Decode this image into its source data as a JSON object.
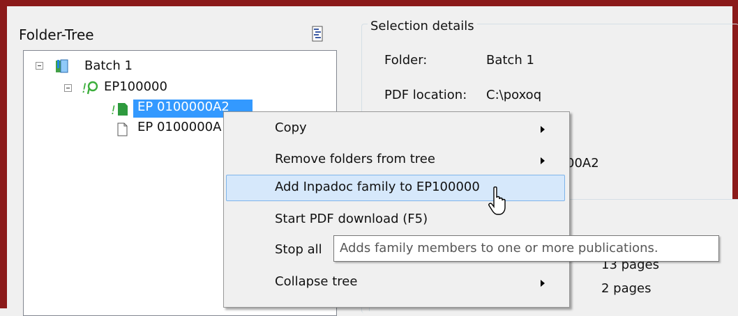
{
  "folder_tree": {
    "title": "Folder-Tree",
    "options_icon": "tree-options-icon",
    "nodes": [
      {
        "label": "Batch 1",
        "icon": "batch-book-icon"
      },
      {
        "label": "EP100000",
        "icon": "family-green-icon"
      },
      {
        "label": "EP 0100000A2",
        "icon": "green-document-icon",
        "selected": true
      },
      {
        "label": "EP 0100000A",
        "icon": "white-document-icon"
      }
    ]
  },
  "selection_details": {
    "title": "Selection details",
    "folder_label": "Folder:",
    "folder_value": "Batch 1",
    "pdf_location_label": "PDF location:",
    "pdf_location_value": "C:\\poxoq",
    "partial_text": "00A2",
    "pages_1": "13 pages",
    "pages_2": "2 pages"
  },
  "context_menu": {
    "items": [
      {
        "label": "Copy",
        "submenu": true
      },
      {
        "label": "Remove folders from tree",
        "submenu": true
      },
      {
        "label": "Add Inpadoc family to EP100000",
        "submenu": false,
        "hovered": true
      },
      {
        "label": "Start PDF download (F5)",
        "submenu": false
      },
      {
        "label": "Stop all",
        "submenu": false
      },
      {
        "label": "Collapse tree",
        "submenu": true
      }
    ]
  },
  "tooltip": {
    "text": "Adds family members to one or more publications."
  },
  "colors": {
    "selection": "#3399ff",
    "menu_hover": "#d6e8fb",
    "window_border": "#8b1a1a"
  }
}
